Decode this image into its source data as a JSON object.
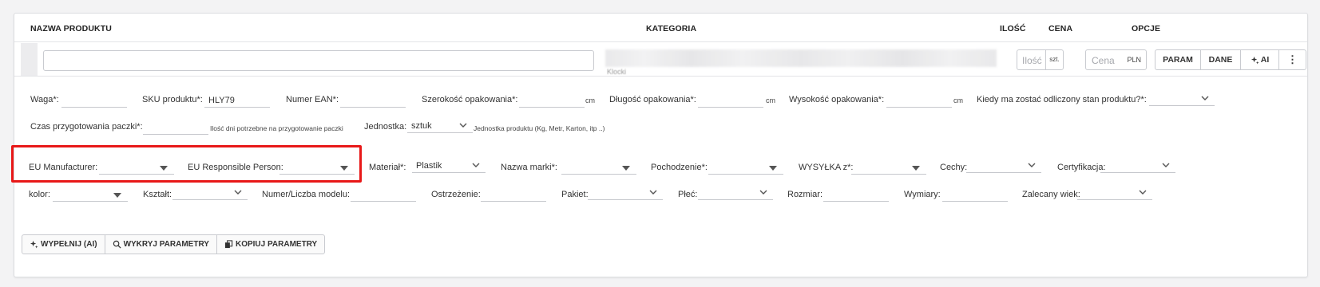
{
  "header": {
    "col_name": "NAZWA PRODUKTU",
    "col_category": "KATEGORIA",
    "col_qty": "ILOŚĆ",
    "col_price": "CENA",
    "col_options": "OPCJE"
  },
  "product_row": {
    "name_value": "",
    "category_text_blurred": "Klocki",
    "qty_placeholder": "Ilość",
    "qty_unit": "szt.",
    "price_placeholder": "Cena",
    "price_currency": "PLN",
    "btn_param": "PARAM",
    "btn_dane": "DANE",
    "btn_ai": "AI",
    "btn_more": "⋮"
  },
  "fields_row1": {
    "weight_label": "Waga*:",
    "weight_value": "",
    "sku_label": "SKU produktu*:",
    "sku_value": "HLY79",
    "ean_label": "Numer EAN*:",
    "ean_value": "",
    "width_label": "Szerokość opakowania*:",
    "width_unit": "cm",
    "length_label": "Długość opakowania*:",
    "length_unit": "cm",
    "height_label": "Wysokość opakowania*:",
    "height_unit": "cm",
    "stock_label": "Kiedy ma zostać odliczony stan produktu?*:",
    "stock_value": ""
  },
  "fields_row2": {
    "prep_label": "Czas przygotowania paczki*:",
    "prep_hint": "Ilość dni potrzebne na przygotowanie paczki",
    "unit_label": "Jednostka:",
    "unit_value": "sztuk",
    "unit_hint": "Jednostka produktu (Kg, Metr, Karton, itp ..)"
  },
  "fields_row3": {
    "eu_manufacturer_label": "EU Manufacturer:",
    "eu_responsible_label": "EU Responsible Person:",
    "material_label": "Materiał*:",
    "material_value": "Plastik",
    "brand_label": "Nazwa marki*:",
    "origin_label": "Pochodzenie*:",
    "shipping_label": "WYSYŁKA z*:",
    "features_label": "Cechy:",
    "cert_label": "Certyfikacja:"
  },
  "fields_row4": {
    "color_label": "kolor:",
    "shape_label": "Kształt:",
    "model_label": "Numer/Liczba modelu:",
    "warning_label": "Ostrzeżenie:",
    "package_label": "Pakiet:",
    "gender_label": "Płeć:",
    "size_label": "Rozmiar:",
    "dimensions_label": "Wymiary:",
    "age_label": "Zalecany wiek:"
  },
  "bottom_actions": {
    "fill_ai": "WYPEŁNIJ (AI)",
    "detect_params": "WYKRYJ PARAMETRY",
    "copy_params": "KOPIUJ PARAMETRY"
  },
  "colors": {
    "highlight": "#e81818",
    "border": "#c9cbd0"
  }
}
